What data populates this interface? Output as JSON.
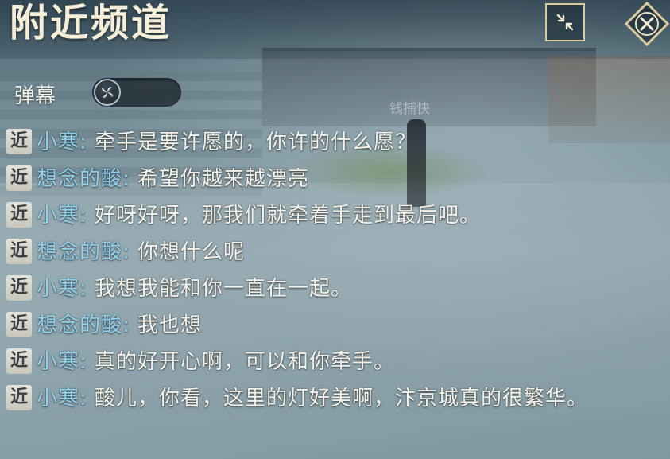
{
  "header": {
    "title": "附近频道",
    "collapse_icon": "collapse-arrows-icon",
    "close_icon": "close-x-icon"
  },
  "scene": {
    "npc_name": "钱捕快"
  },
  "danmaku": {
    "label": "弹幕",
    "enabled": false
  },
  "chat": {
    "channel_tag": "近",
    "messages": [
      {
        "sender": "小寒",
        "sep": ":",
        "text": "牵手是要许愿的，你许的什么愿？"
      },
      {
        "sender": "想念的酸",
        "sep": ":",
        "text": "希望你越来越漂亮"
      },
      {
        "sender": "小寒",
        "sep": ":",
        "text": "好呀好呀，那我们就牵着手走到最后吧。"
      },
      {
        "sender": "想念的酸",
        "sep": ":",
        "text": "你想什么呢"
      },
      {
        "sender": "小寒",
        "sep": ":",
        "text": "我想我能和你一直在一起。"
      },
      {
        "sender": "想念的酸",
        "sep": ":",
        "text": "我也想"
      },
      {
        "sender": "小寒",
        "sep": ":",
        "text": "真的好开心啊，可以和你牵手。"
      },
      {
        "sender": "小寒",
        "sep": ":",
        "text": "酸儿，你看，这里的灯好美啊，汴京城真的很繁华。"
      }
    ]
  },
  "colors": {
    "title": "#f6eed8",
    "sender": "#8fd2f0",
    "message": "#f4f1e8",
    "button_border": "#d9caa0"
  }
}
